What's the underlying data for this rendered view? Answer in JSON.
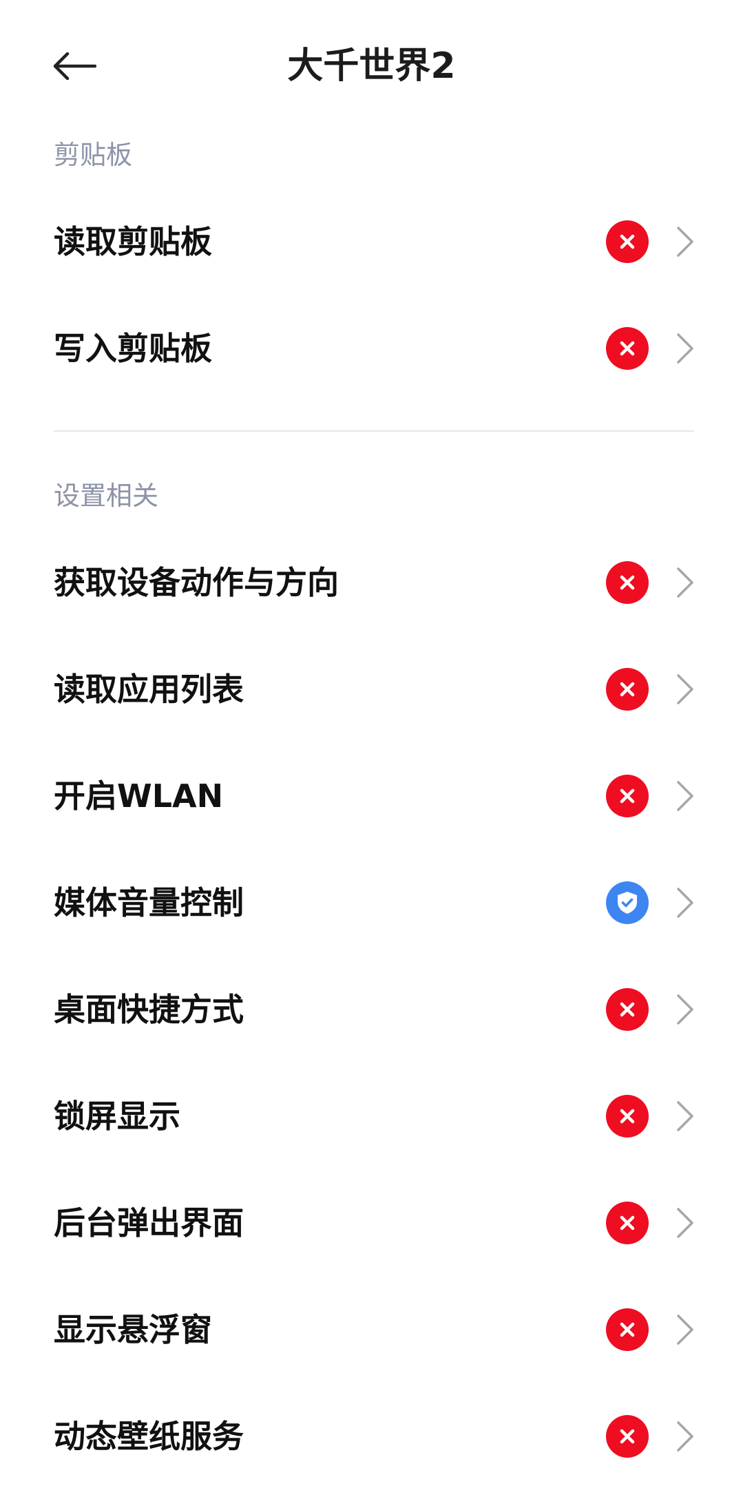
{
  "header": {
    "title": "大千世界2"
  },
  "sections": [
    {
      "label": "剪贴板",
      "items": [
        {
          "label": "读取剪贴板",
          "status": "denied"
        },
        {
          "label": "写入剪贴板",
          "status": "denied"
        }
      ]
    },
    {
      "label": "设置相关",
      "items": [
        {
          "label": "获取设备动作与方向",
          "status": "denied"
        },
        {
          "label": "读取应用列表",
          "status": "denied"
        },
        {
          "label": "开启WLAN",
          "status": "denied"
        },
        {
          "label": "媒体音量控制",
          "status": "allowed"
        },
        {
          "label": "桌面快捷方式",
          "status": "denied"
        },
        {
          "label": "锁屏显示",
          "status": "denied"
        },
        {
          "label": "后台弹出界面",
          "status": "denied"
        },
        {
          "label": "显示悬浮窗",
          "status": "denied"
        },
        {
          "label": "动态壁纸服务",
          "status": "denied"
        }
      ]
    }
  ],
  "colors": {
    "denied": "#ef0d22",
    "allowed": "#3d86f2",
    "section_label": "#8c93a8"
  },
  "icons": {
    "back": "arrow-left-icon",
    "denied": "x-circle-icon",
    "allowed": "shield-check-icon",
    "chevron": "chevron-right-icon"
  }
}
